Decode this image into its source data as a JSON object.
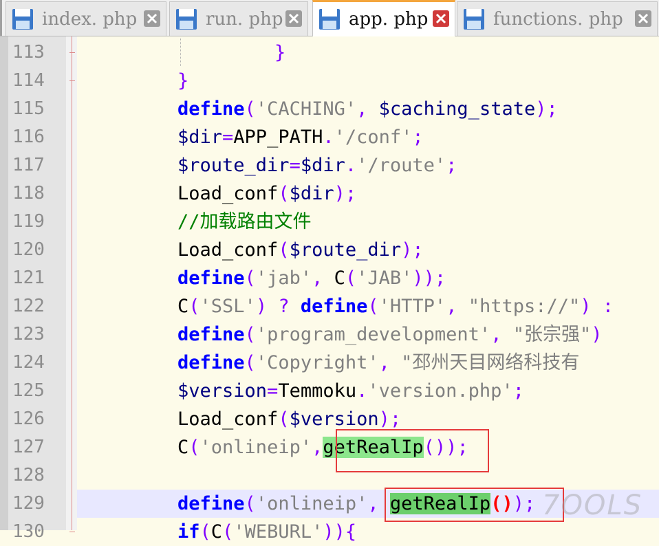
{
  "tabs": [
    {
      "label": "index. php",
      "active": false
    },
    {
      "label": "run. php",
      "active": false
    },
    {
      "label": "app. php",
      "active": true
    },
    {
      "label": "functions. php",
      "active": false
    }
  ],
  "colors": {
    "keyword": "#0000ff",
    "operator": "#8000ff",
    "string": "#808080",
    "comment": "#008000",
    "highlight": "#8ce68c",
    "annotation_box": "#e53b3b",
    "active_tab_accent": "#f4a63d"
  },
  "icons": {
    "tab_icon": "save-floppy-icon",
    "tab_close": "close-x-icon"
  },
  "editor": {
    "current_line": 129,
    "lines": [
      {
        "num": "113",
        "tokens": [
          {
            "t": "    }",
            "c": "tok-op"
          }
        ]
      },
      {
        "num": "114",
        "tokens": [
          {
            "t": "}",
            "c": "tok-op"
          }
        ]
      },
      {
        "num": "115",
        "tokens": [
          {
            "t": "define",
            "c": "tok-kw"
          },
          {
            "t": "(",
            "c": "tok-op"
          },
          {
            "t": "'CACHING'",
            "c": "tok-str"
          },
          {
            "t": ", ",
            "c": "tok-op"
          },
          {
            "t": "$caching_state",
            "c": "tok-var"
          },
          {
            "t": ");",
            "c": "tok-op"
          }
        ]
      },
      {
        "num": "116",
        "tokens": [
          {
            "t": "$dir",
            "c": "tok-var"
          },
          {
            "t": "=",
            "c": "tok-op"
          },
          {
            "t": "APP_PATH",
            "c": "tok-fn"
          },
          {
            "t": ".",
            "c": "tok-op"
          },
          {
            "t": "'/conf'",
            "c": "tok-str"
          },
          {
            "t": ";",
            "c": "tok-op"
          }
        ]
      },
      {
        "num": "117",
        "tokens": [
          {
            "t": "$route_dir",
            "c": "tok-var"
          },
          {
            "t": "=",
            "c": "tok-op"
          },
          {
            "t": "$dir",
            "c": "tok-var"
          },
          {
            "t": ".",
            "c": "tok-op"
          },
          {
            "t": "'/route'",
            "c": "tok-str"
          },
          {
            "t": ";",
            "c": "tok-op"
          }
        ]
      },
      {
        "num": "118",
        "tokens": [
          {
            "t": "Load_conf",
            "c": "tok-fn"
          },
          {
            "t": "(",
            "c": "tok-op"
          },
          {
            "t": "$dir",
            "c": "tok-var"
          },
          {
            "t": ");",
            "c": "tok-op"
          }
        ]
      },
      {
        "num": "119",
        "tokens": [
          {
            "t": "//加载路由文件",
            "c": "tok-cm"
          }
        ]
      },
      {
        "num": "120",
        "tokens": [
          {
            "t": "Load_conf",
            "c": "tok-fn"
          },
          {
            "t": "(",
            "c": "tok-op"
          },
          {
            "t": "$route_dir",
            "c": "tok-var"
          },
          {
            "t": ");",
            "c": "tok-op"
          }
        ]
      },
      {
        "num": "121",
        "tokens": [
          {
            "t": "define",
            "c": "tok-kw"
          },
          {
            "t": "(",
            "c": "tok-op"
          },
          {
            "t": "'jab'",
            "c": "tok-str"
          },
          {
            "t": ", ",
            "c": "tok-op"
          },
          {
            "t": "C",
            "c": "tok-fn"
          },
          {
            "t": "(",
            "c": "tok-op"
          },
          {
            "t": "'JAB'",
            "c": "tok-str"
          },
          {
            "t": "));",
            "c": "tok-op"
          }
        ]
      },
      {
        "num": "122",
        "tokens": [
          {
            "t": "C",
            "c": "tok-fn"
          },
          {
            "t": "(",
            "c": "tok-op"
          },
          {
            "t": "'SSL'",
            "c": "tok-str"
          },
          {
            "t": ") ? ",
            "c": "tok-op"
          },
          {
            "t": "define",
            "c": "tok-kw"
          },
          {
            "t": "(",
            "c": "tok-op"
          },
          {
            "t": "'HTTP'",
            "c": "tok-str"
          },
          {
            "t": ", ",
            "c": "tok-op"
          },
          {
            "t": "\"https://\"",
            "c": "tok-str"
          },
          {
            "t": ") :",
            "c": "tok-op"
          }
        ]
      },
      {
        "num": "123",
        "tokens": [
          {
            "t": "define",
            "c": "tok-kw"
          },
          {
            "t": "(",
            "c": "tok-op"
          },
          {
            "t": "'program_development'",
            "c": "tok-str"
          },
          {
            "t": ", ",
            "c": "tok-op"
          },
          {
            "t": "\"张宗强\"",
            "c": "tok-str"
          },
          {
            "t": ")",
            "c": "tok-op"
          }
        ]
      },
      {
        "num": "124",
        "tokens": [
          {
            "t": "define",
            "c": "tok-kw"
          },
          {
            "t": "(",
            "c": "tok-op"
          },
          {
            "t": "'Copyright'",
            "c": "tok-str"
          },
          {
            "t": ", ",
            "c": "tok-op"
          },
          {
            "t": "\"邳州天目网络科技有",
            "c": "tok-str"
          }
        ]
      },
      {
        "num": "125",
        "tokens": [
          {
            "t": "$version",
            "c": "tok-var"
          },
          {
            "t": "=",
            "c": "tok-op"
          },
          {
            "t": "Temmoku",
            "c": "tok-fn"
          },
          {
            "t": ".",
            "c": "tok-op"
          },
          {
            "t": "'version.php'",
            "c": "tok-str"
          },
          {
            "t": ";",
            "c": "tok-op"
          }
        ]
      },
      {
        "num": "126",
        "tokens": [
          {
            "t": "Load_conf",
            "c": "tok-fn"
          },
          {
            "t": "(",
            "c": "tok-op"
          },
          {
            "t": "$version",
            "c": "tok-var"
          },
          {
            "t": ");",
            "c": "tok-op"
          }
        ]
      },
      {
        "num": "127",
        "tokens": [
          {
            "t": "C",
            "c": "tok-fn"
          },
          {
            "t": "(",
            "c": "tok-op"
          },
          {
            "t": "'onlineip'",
            "c": "tok-str"
          },
          {
            "t": ",",
            "c": "tok-op"
          },
          {
            "t": "getRealIp",
            "c": "tok-fn tok-hl"
          },
          {
            "t": "());",
            "c": "tok-op"
          }
        ]
      },
      {
        "num": "128",
        "tokens": []
      },
      {
        "num": "129",
        "tokens": [
          {
            "t": "define",
            "c": "tok-kw"
          },
          {
            "t": "(",
            "c": "tok-op"
          },
          {
            "t": "'onlineip'",
            "c": "tok-str"
          },
          {
            "t": ", ",
            "c": "tok-op"
          },
          {
            "t": "getRealIp",
            "c": "tok-fn tok-hl2"
          },
          {
            "t": "()",
            "c": "tok-brace"
          },
          {
            "t": ");",
            "c": "tok-op"
          }
        ]
      },
      {
        "num": "130",
        "tokens": [
          {
            "t": "if",
            "c": "tok-kw"
          },
          {
            "t": "(",
            "c": "tok-op"
          },
          {
            "t": "C",
            "c": "tok-fn"
          },
          {
            "t": "(",
            "c": "tok-op"
          },
          {
            "t": "'WEBURL'",
            "c": "tok-str"
          },
          {
            "t": ")){",
            "c": "tok-op"
          }
        ]
      }
    ]
  },
  "watermark": "7OOLS"
}
